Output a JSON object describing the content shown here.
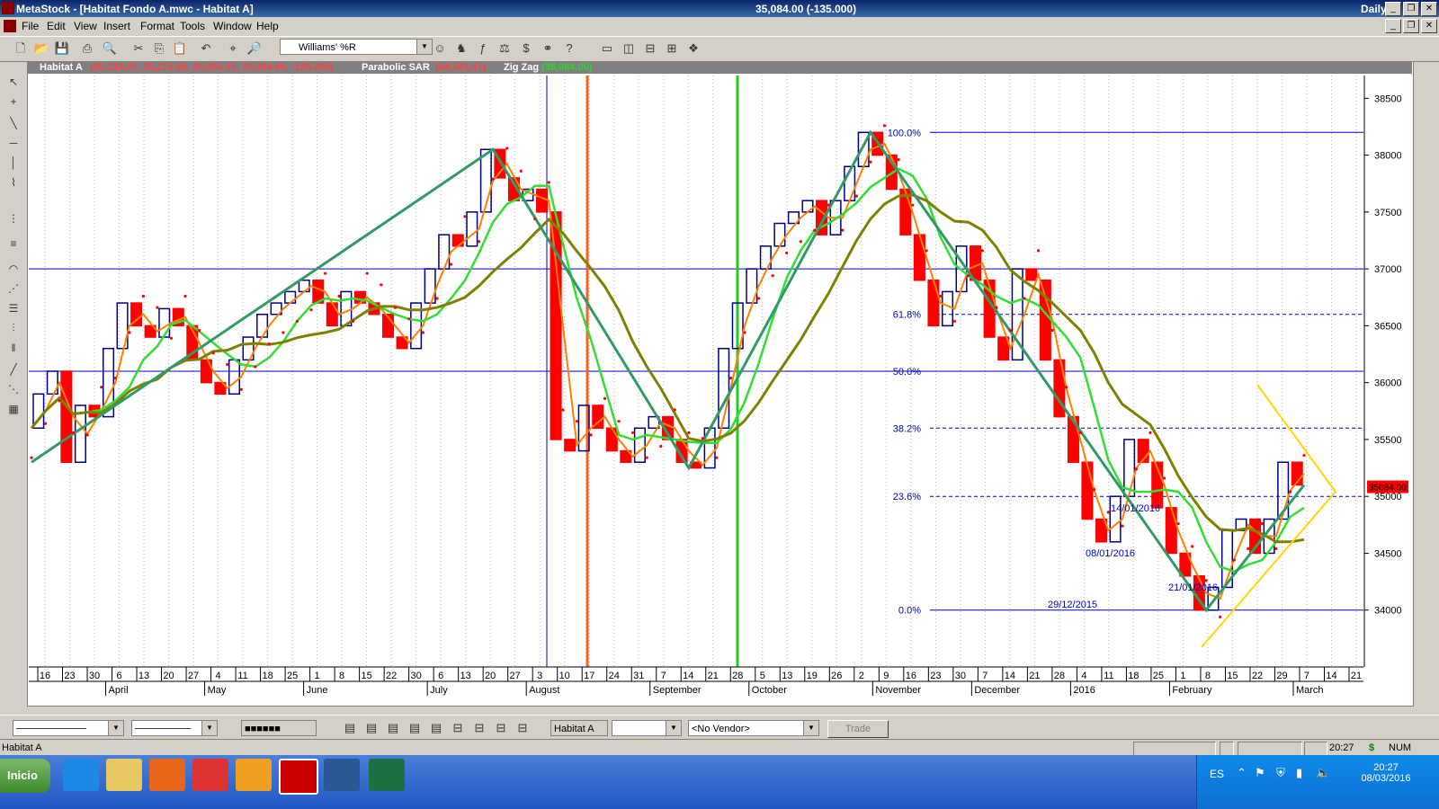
{
  "window": {
    "app_title": "MetaStock - [Habitat Fondo A.mwc - Habitat A]",
    "center_text": "35,084.00 (-135.000)",
    "periodicity": "Daily"
  },
  "menu": [
    "File",
    "Edit",
    "View",
    "Insert",
    "Format",
    "Tools",
    "Window",
    "Help"
  ],
  "toolbar": {
    "indicator_select": "Williams' %R"
  },
  "chart_header": {
    "security": "Habitat A",
    "ohlc": "(35,219.00, 35,219.00, 35,084.00, 35,084.00, -135.000)",
    "sar_label": "Parabolic SAR",
    "sar_value": "(34,481.41)",
    "zigzag_label": "Zig Zag",
    "zigzag_value": "(35,084.00)"
  },
  "chart_data": {
    "type": "line",
    "title": "",
    "ylim": [
      33500,
      38700
    ],
    "yticks": [
      34000,
      34500,
      35000,
      35500,
      36000,
      36500,
      37000,
      37500,
      38000,
      38500
    ],
    "x_day_labels": [
      "16",
      "23",
      "30",
      "6",
      "13",
      "20",
      "27",
      "4",
      "11",
      "18",
      "25",
      "1",
      "8",
      "15",
      "22",
      "30",
      "6",
      "13",
      "20",
      "27",
      "3",
      "10",
      "17",
      "24",
      "31",
      "7",
      "14",
      "21",
      "28",
      "5",
      "13",
      "19",
      "26",
      "2",
      "9",
      "16",
      "23",
      "30",
      "7",
      "14",
      "21",
      "28",
      "4",
      "11",
      "18",
      "25",
      "1",
      "8",
      "15",
      "22",
      "29",
      "7",
      "14",
      "21"
    ],
    "x_month_labels": [
      "April",
      "May",
      "June",
      "July",
      "August",
      "September",
      "October",
      "November",
      "December",
      "2016",
      "February",
      "March"
    ],
    "last_price_label": "35084.00",
    "series": [
      {
        "values": [
          35600,
          35900,
          36100,
          35300,
          35800,
          35700,
          36300,
          36700,
          36500,
          36400,
          36650,
          36500,
          36200,
          36000,
          35900,
          36200,
          36400,
          36600,
          36700,
          36800,
          36900,
          36700,
          36500,
          36800,
          36700,
          36600,
          36400,
          36300,
          36700,
          37000,
          37300,
          37200,
          37500,
          38050,
          37800,
          37600,
          37700,
          37500,
          35500,
          35400,
          35800,
          35600,
          35400,
          35300,
          35600,
          35700,
          35500,
          35300,
          35250,
          35600,
          36300,
          36700,
          37000,
          37200,
          37400,
          37500,
          37600,
          37300,
          37600,
          37900,
          38200,
          38000,
          37700,
          37300,
          36900,
          36500,
          36800,
          37200,
          36900,
          36400,
          36200,
          37000,
          36900,
          36200,
          35700,
          35300,
          34800,
          34600,
          35000,
          35500,
          35300,
          34900,
          34500,
          34300,
          34000,
          34200,
          34700,
          34800,
          34500,
          34800,
          35300,
          35100
        ]
      },
      {
        "name": "Parabolic SAR",
        "last": 34481.41
      }
    ],
    "fibonacci_levels": [
      {
        "label": "100.0%",
        "value": 38200
      },
      {
        "label": "61.8%",
        "value": 36600
      },
      {
        "label": "50.0%",
        "value": 36100
      },
      {
        "label": "38.2%",
        "value": 35600
      },
      {
        "label": "23.6%",
        "value": 35000
      },
      {
        "label": "0.0%",
        "value": 34000
      }
    ],
    "horizontal_line": 37000,
    "annotations": [
      "29/12/2015",
      "08/01/2016",
      "14/01/2016",
      "21/01/2016"
    ]
  },
  "bottom": {
    "security_select": "Habitat A",
    "vendor_select": "<No Vendor>",
    "trade_label": "Trade"
  },
  "status": {
    "left": "Habitat A",
    "time": "20:27",
    "num": "NUM"
  },
  "taskbar": {
    "start": "Inicio",
    "lang": "ES",
    "clock_time": "20:27",
    "clock_date": "08/03/2016"
  },
  "colors": {
    "axis_text": "#000000",
    "fib_text": "#0000cc",
    "bar_up": "#000080",
    "bar_down": "#ff0000",
    "sma_fast": "#ff8000",
    "sma_mid": "#33dd33",
    "sma_slow": "#808000",
    "zigzag": "#339966"
  }
}
